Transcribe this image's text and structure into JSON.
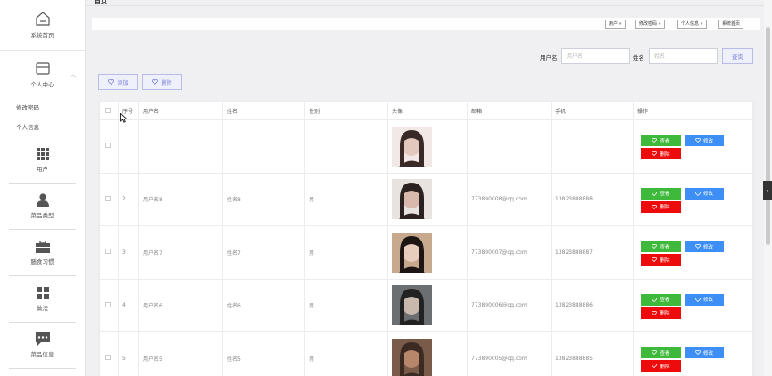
{
  "sidebar": {
    "home_label": "系统首页",
    "personal_label": "个人中心",
    "personal_sub": [
      "修改密码",
      "个人信息"
    ],
    "menu": [
      {
        "label": "用户",
        "icon": "grid-icon"
      },
      {
        "label": "菜品类型",
        "icon": "user-icon"
      },
      {
        "label": "膳食习惯",
        "icon": "briefcase-icon"
      },
      {
        "label": "做法",
        "icon": "apps-icon"
      },
      {
        "label": "菜品信息",
        "icon": "chat-icon"
      }
    ]
  },
  "breadcrumb": {
    "current": "首页"
  },
  "toolbar": {
    "buttons": [
      "用户 »",
      "修改密码 »",
      "个人信息 »",
      "系统首页"
    ]
  },
  "search": {
    "username_label": "用户名",
    "username_placeholder": "用户名",
    "name_label": "姓名",
    "name_placeholder": "姓名",
    "button": "查询"
  },
  "actions": {
    "add": "添加",
    "delete": "删除"
  },
  "table": {
    "headers": [
      "序号",
      "用户名",
      "姓名",
      "性别",
      "头像",
      "邮箱",
      "手机",
      "操作"
    ],
    "rows": [
      {
        "index": "",
        "username": "",
        "name": "",
        "gender": "",
        "email": "",
        "phone": ""
      },
      {
        "index": "2",
        "username": "用户名8",
        "name": "姓名8",
        "gender": "男",
        "email": "773890008@qq.com",
        "phone": "13823888888"
      },
      {
        "index": "3",
        "username": "用户名7",
        "name": "姓名7",
        "gender": "男",
        "email": "773890007@qq.com",
        "phone": "13823888887"
      },
      {
        "index": "4",
        "username": "用户名6",
        "name": "姓名6",
        "gender": "男",
        "email": "773890006@qq.com",
        "phone": "13823888886"
      },
      {
        "index": "5",
        "username": "用户名5",
        "name": "姓名5",
        "gender": "男",
        "email": "773890005@qq.com",
        "phone": "13823888885"
      }
    ],
    "op_labels": {
      "view": "查看",
      "edit": "修改",
      "delete": "删除"
    }
  },
  "side_tab": "‹",
  "colors": {
    "accent": "#7b7fd4",
    "view": "#3fb93c",
    "edit": "#3d8ff5",
    "delete": "#ee0b0b"
  }
}
